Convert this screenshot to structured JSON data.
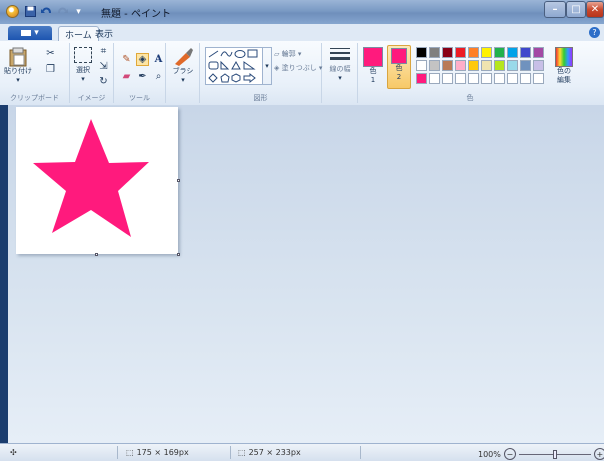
{
  "window": {
    "title": "無題 - ペイント",
    "minimize_label": "–",
    "maximize_label": "□",
    "close_label": "✕"
  },
  "tabs": {
    "app_menu": "▾",
    "home": "ホーム",
    "view": "表示",
    "help": "?"
  },
  "ribbon": {
    "clipboard": {
      "paste_label": "貼り付け",
      "group_label": "クリップボード"
    },
    "image": {
      "select_label": "選択",
      "group_label": "イメージ"
    },
    "tools": {
      "group_label": "ツール"
    },
    "brush": {
      "label": "ブラシ"
    },
    "shapes": {
      "outline_label": "輪郭 ▾",
      "fill_label": "塗りつぶし ▾",
      "group_label": "図形"
    },
    "line_width": {
      "label": "線の幅"
    },
    "colors": {
      "color1_label": "色",
      "color1_num": "1",
      "color2_label": "色",
      "color2_num": "2",
      "edit_colors_label": "色の編集",
      "group_label": "色",
      "color1_value": "#ff1a7d",
      "color2_value": "#ff1a7d",
      "palette_row1": [
        "#000000",
        "#7f7f7f",
        "#880015",
        "#ed1c24",
        "#ff7f27",
        "#fff200",
        "#22b14c",
        "#00a2e8",
        "#3f48cc",
        "#a349a4"
      ],
      "palette_row2": [
        "#ffffff",
        "#c3c3c3",
        "#b97a57",
        "#ffaec9",
        "#ffc90e",
        "#efe4b0",
        "#b5e61d",
        "#99d9ea",
        "#7092be",
        "#c8bfe7"
      ],
      "palette_row3": [
        "#ff1a7d",
        "#ffffff",
        "#ffffff",
        "#ffffff",
        "#ffffff",
        "#ffffff",
        "#ffffff",
        "#ffffff",
        "#ffffff",
        "#ffffff"
      ]
    }
  },
  "canvas": {
    "star_color": "#ff1a7d"
  },
  "status": {
    "cursor_icon": "move-icon",
    "selection_size": "175 × 169px",
    "image_size": "257 × 233px",
    "zoom": "100%",
    "zoom_out": "−",
    "zoom_in": "+"
  }
}
